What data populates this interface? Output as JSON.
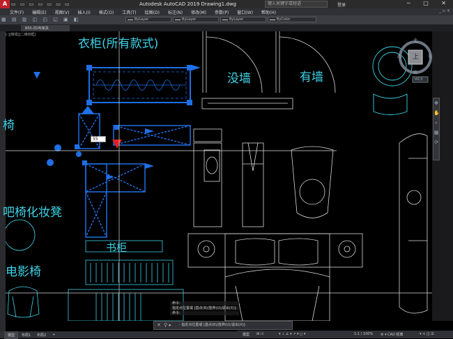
{
  "titlebar": {
    "app_logo": "A",
    "qat": "▭ ▭ ▭ ▭ ▭ ▭ ▭",
    "title": "Autodesk AutoCAD 2019    Drawing1.dwg",
    "search_placeholder": "键入关键字或短语",
    "login": "登录",
    "window_buttons": "─ □ ✕"
  },
  "menubar": {
    "items": [
      "文件(F)",
      "编辑(E)",
      "视图(V)",
      "插入(I)",
      "格式(O)",
      "工具(T)",
      "绘图(D)",
      "标注(N)",
      "修改(M)",
      "参数(P)",
      "窗口(W)",
      "帮助(H)"
    ],
    "right": "_ ▫ ×"
  },
  "ribbon": {
    "icons": "▦ ▤ ▥ ◫ ◰ ◱ ▣ ◧",
    "layer_1": "ByLayer",
    "layer_2": "ByLayer",
    "layer_3": "ByColor"
  },
  "filetabs": {
    "tab_1": "BS5-ZD布家具",
    "tab_1_close": "×"
  },
  "viewport_label": "[-][俯视][二维线框]",
  "dynamic_input": "55",
  "viewcube": {
    "top_face": "上",
    "north": "北",
    "south": "南",
    "east": "东",
    "west": "西",
    "wcs": "WCS"
  },
  "nav_bar": {
    "icons": [
      "✥",
      "✋",
      "⌕",
      "▦",
      "⟳"
    ]
  },
  "cad_labels": {
    "wardrobe": "衣柜(所有款式)",
    "no_wall": "没墙",
    "with_wall": "有墙",
    "chair": "椅",
    "dresser_chair": "吧椅化妆凳",
    "bookcase": "书柜",
    "movie_chair": "电影椅"
  },
  "command": {
    "history_1": "命令:",
    "history_2": "指定点位置或 [基点(B)/放弃(U)/退出(X)]:",
    "history_3": "命令:",
    "prompt": "- 指定点位置或 [基点(B)/放弃(U)/退出(X)]:",
    "close_icon": "✕",
    "tool_icons": "⚲ ▸"
  },
  "layout": {
    "model": "模型",
    "layout1": "布局1",
    "layout2": "布局2",
    "add": "+"
  },
  "status": {
    "model": "模型",
    "grid": "⊞ ⁞⁞⁞",
    "snap": "▾ ⊥ ∠ ▾ ↗ ▾ ◻ ▾",
    "scale": "1:1 / 100%",
    "workspace": "⚙ ▾  CAD 经典",
    "tools": "▾ + ◫ ☰"
  },
  "colors": {
    "cad_cyan": "#3fd3e8",
    "selection_blue": "#1f6fe6",
    "background": "#000000",
    "chrome_dark": "#2f3136"
  }
}
